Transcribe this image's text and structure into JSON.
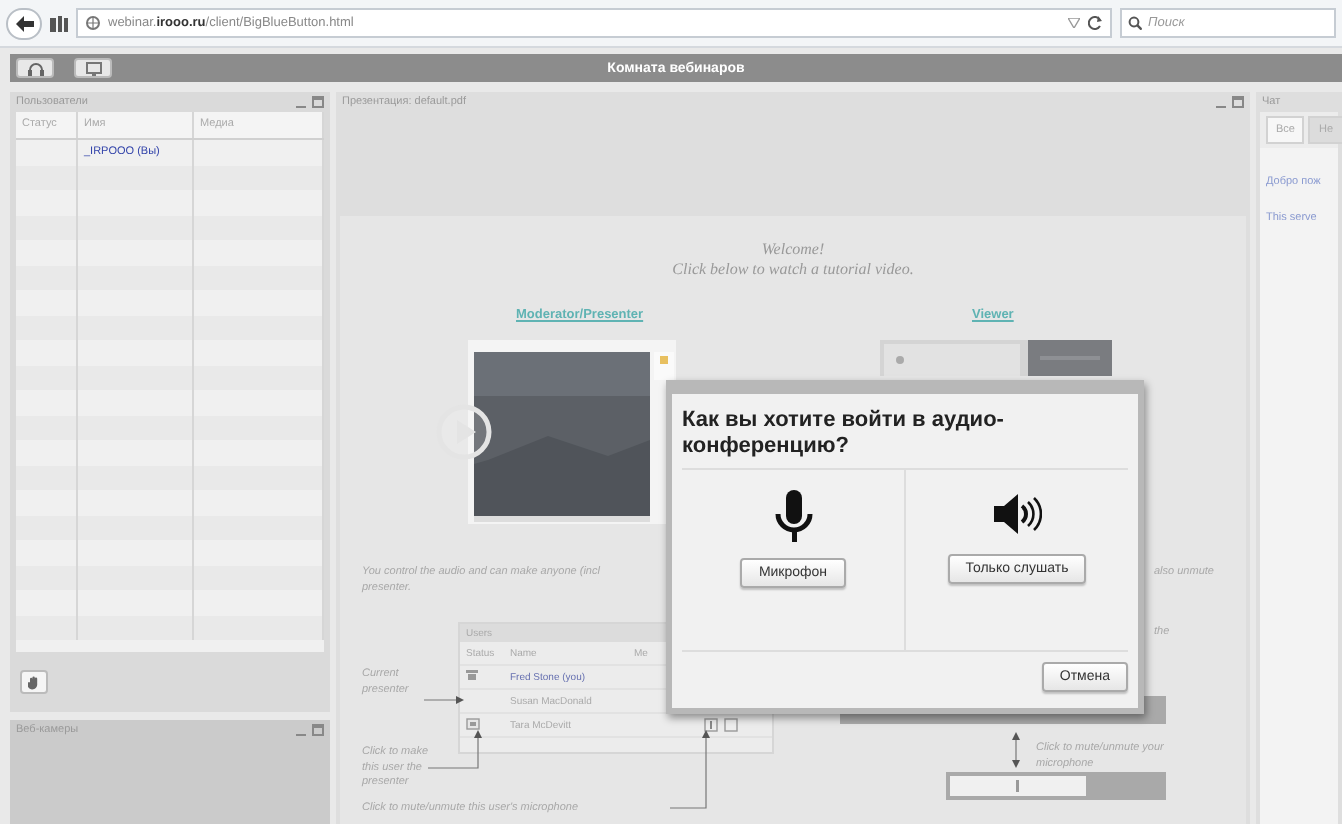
{
  "browser": {
    "url": "webinar.**irooo.ru**/client/BigBlueButton.html",
    "search": {
      "placeholder": "Поиск"
    }
  },
  "app_header": {
    "title": "Комната вебинаров"
  },
  "users_panel": {
    "title": "Пользователи",
    "columns": [
      "Статус",
      "Имя",
      "Медиа"
    ],
    "rows": [
      {
        "name": "_IRPOOO (Вы)"
      }
    ]
  },
  "webcams_panel": {
    "title": "Веб-камеры"
  },
  "presentation_panel": {
    "title": "Презентация: default.pdf",
    "slide": {
      "welcome_title": "Welcome!",
      "welcome_subtitle": "Click below to watch a tutorial video.",
      "links": [
        "Moderator/Presenter",
        "Viewer"
      ],
      "paragraph_lines": [
        "You control the audio and can make anyone (incl",
        "presenter."
      ],
      "paragraph_tail": "also unmute",
      "side_note": "the",
      "users_table": {
        "title": "Users",
        "columns": [
          "Status",
          "Name",
          "Me"
        ],
        "rows": [
          {
            "kind": "presenter",
            "name": "Fred Stone (you)"
          },
          {
            "kind": "plain",
            "name": "Susan MacDonald"
          },
          {
            "kind": "controls",
            "name": "Tara McDevitt"
          }
        ]
      },
      "callouts": [
        "Current presenter",
        "Click to make this user the presenter",
        "Click to mute/unmute this user's microphone",
        "Click to mute/unmute your microphone"
      ]
    }
  },
  "chat_panel": {
    "title": "Чат",
    "tabs": [
      {
        "label": "Все",
        "selected": true
      },
      {
        "label": "Не",
        "selected": false
      }
    ],
    "messages": [
      "Добро пож",
      "This serve"
    ]
  },
  "dialog": {
    "title": "Как вы хотите войти в аудио-конференцию?",
    "options": [
      {
        "kind": "microphone",
        "label": "Микрофон"
      },
      {
        "kind": "listen",
        "label": "Только слушать"
      }
    ],
    "cancel": "Отмена"
  }
}
